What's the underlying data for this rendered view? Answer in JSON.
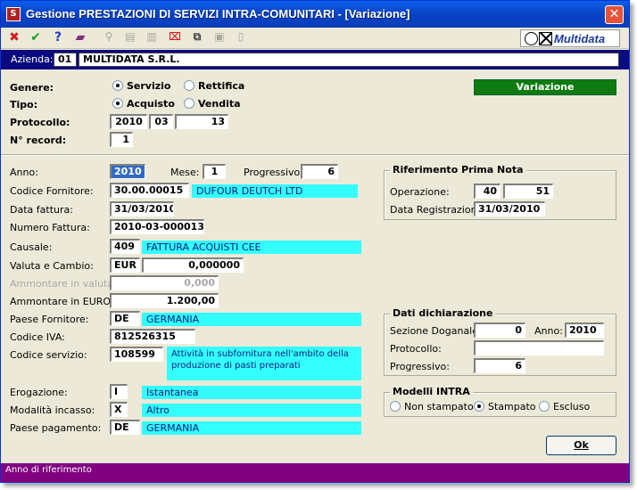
{
  "window": {
    "title": "Gestione PRESTAZIONI DI SERVIZI INTRA-COMUNITARI - [Variazione]",
    "close_glyph": "✕"
  },
  "toolbar": {
    "icons": [
      "delete-icon",
      "confirm-icon",
      "help-icon",
      "book-icon",
      "binoculars-icon",
      "print-icon",
      "print-preview-icon",
      "delete-record-icon",
      "copy-icon",
      "paste-icon",
      "new-page-icon"
    ],
    "logo_text": "Multidata"
  },
  "azienda": {
    "label": "Azienda:",
    "code": "01",
    "name": "MULTIDATA S.R.L."
  },
  "header": {
    "genere_label": "Genere:",
    "genere_options": [
      "Servizio",
      "Rettifica"
    ],
    "genere_selected": "Servizio",
    "tipo_label": "Tipo:",
    "tipo_options": [
      "Acquisto",
      "Vendita"
    ],
    "tipo_selected": "Acquisto",
    "protocollo_label": "Protocollo:",
    "protocollo_year": "2010",
    "protocollo_month": "03",
    "protocollo_num": "13",
    "record_label": "N° record:",
    "record_value": "1",
    "mode_badge": "Variazione"
  },
  "form": {
    "anno_label": "Anno:",
    "anno_value": "2010",
    "mese_label": "Mese:",
    "mese_value": "1",
    "progressivo_label": "Progressivo:",
    "progressivo_value": "6",
    "fornitore_label": "Codice Fornitore:",
    "fornitore_code": "30.00.00015",
    "fornitore_name": "DUFOUR DEUTCH LTD",
    "data_fattura_label": "Data fattura:",
    "data_fattura_value": "31/03/2010",
    "numero_fattura_label": "Numero Fattura:",
    "numero_fattura_value": "2010-03-000013",
    "causale_label": "Causale:",
    "causale_code": "409",
    "causale_desc": "FATTURA ACQUISTI CEE",
    "valuta_label": "Valuta e Cambio:",
    "valuta_code": "EUR",
    "cambio_value": "0,000000",
    "amm_valuta_label": "Ammontare in valuta:",
    "amm_valuta_value": "0,000",
    "amm_euro_label": "Ammontare in EURO:",
    "amm_euro_value": "1.200,00",
    "paese_fornitore_label": "Paese Fornitore:",
    "paese_fornitore_code": "DE",
    "paese_fornitore_name": "GERMANIA",
    "iva_label": "Codice IVA:",
    "iva_value": "812526315",
    "servizio_label": "Codice servizio:",
    "servizio_code": "108599",
    "servizio_desc": "Attività in subfornitura nell'ambito della produzione di pasti preparati",
    "erogazione_label": "Erogazione:",
    "erogazione_code": "I",
    "erogazione_desc": "Istantanea",
    "incasso_label": "Modalità incasso:",
    "incasso_code": "X",
    "incasso_desc": "Altro",
    "paese_pag_label": "Paese pagamento:",
    "paese_pag_code": "DE",
    "paese_pag_name": "GERMANIA"
  },
  "prima_nota": {
    "title": "Riferimento Prima Nota",
    "operazione_label": "Operazione:",
    "operazione_a": "40",
    "operazione_b": "51",
    "data_reg_label": "Data Registrazione:",
    "data_reg_value": "31/03/2010"
  },
  "dichiarazione": {
    "title": "Dati dichiarazione",
    "sezione_label": "Sezione Doganale:",
    "sezione_value": "0",
    "anno_label": "Anno:",
    "anno_value": "2010",
    "protocollo_label": "Protocollo:",
    "protocollo_value": "",
    "progressivo_label": "Progressivo:",
    "progressivo_value": "6"
  },
  "modelli": {
    "title": "Modelli INTRA",
    "options": [
      "Non stampato",
      "Stampato",
      "Escluso"
    ],
    "selected": "Stampato"
  },
  "ok_label": "Ok",
  "status_text": "Anno di riferimento"
}
